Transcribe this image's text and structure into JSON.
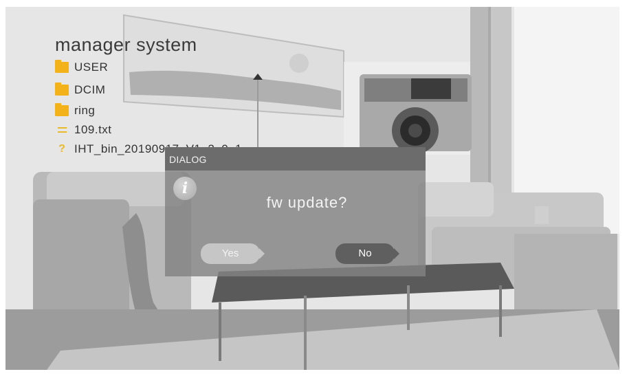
{
  "screen": {
    "title": "manager system"
  },
  "files": [
    {
      "name": "USER",
      "icon": "folder-icon"
    },
    {
      "name": "DCIM",
      "icon": "folder-icon"
    },
    {
      "name": "ring",
      "icon": "folder-icon"
    },
    {
      "name": "109.txt",
      "icon": "text-file-icon"
    },
    {
      "name": "IHT_bin_20190917_V1_2_0_1",
      "icon": "unknown-file-icon"
    }
  ],
  "dialog": {
    "header": "DIALOG",
    "icon": "info-icon",
    "message": "fw update?",
    "yes_label": "Yes",
    "no_label": "No"
  },
  "colors": {
    "folder": "#f3b21a",
    "dialog_header": "#6c6c6c",
    "no_button": "#5f5f5f",
    "yes_button": "#c6c6c6"
  }
}
